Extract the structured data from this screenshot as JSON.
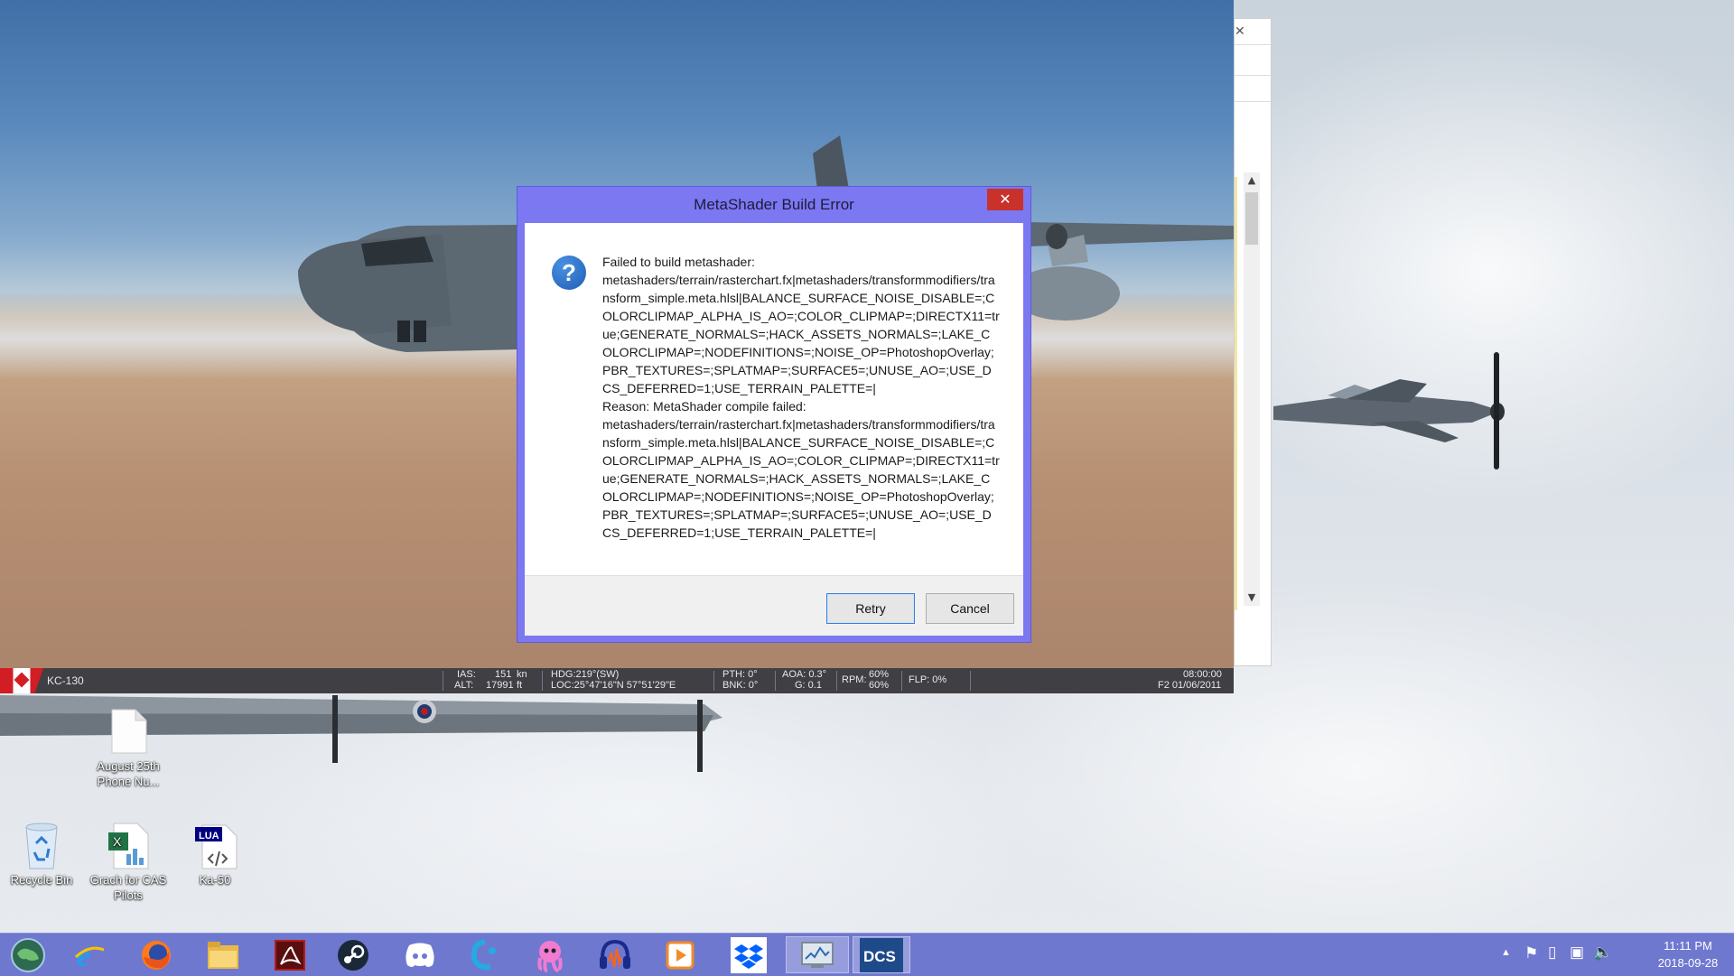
{
  "dialog": {
    "title": "MetaShader Build Error",
    "close_glyph": "✕",
    "message": "Failed to build metashader:\nmetashaders/terrain/rasterchart.fx|metashaders/transformmodifiers/transform_simple.meta.hlsl|BALANCE_SURFACE_NOISE_DISABLE=;COLORCLIPMAP_ALPHA_IS_AO=;COLOR_CLIPMAP=;DIRECTX11=true;GENERATE_NORMALS=;HACK_ASSETS_NORMALS=;LAKE_COLORCLIPMAP=;NODEFINITIONS=;NOISE_OP=PhotoshopOverlay;PBR_TEXTURES=;SPLATMAP=;SURFACE5=;UNUSE_AO=;USE_DCS_DEFERRED=1;USE_TERRAIN_PALETTE=|\nReason: MetaShader compile failed:\nmetashaders/terrain/rasterchart.fx|metashaders/transformmodifiers/transform_simple.meta.hlsl|BALANCE_SURFACE_NOISE_DISABLE=;COLORCLIPMAP_ALPHA_IS_AO=;COLOR_CLIPMAP=;DIRECTX11=true;GENERATE_NORMALS=;HACK_ASSETS_NORMALS=;LAKE_COLORCLIPMAP=;NODEFINITIONS=;NOISE_OP=PhotoshopOverlay;PBR_TEXTURES=;SPLATMAP=;SURFACE5=;UNUSE_AO=;USE_DCS_DEFERRED=1;USE_TERRAIN_PALETTE=|",
    "icon": "question-icon",
    "buttons": {
      "retry": "Retry",
      "cancel": "Cancel"
    }
  },
  "hud": {
    "aircraft": "KC-130",
    "ias_label": "IAS:",
    "ias_value": "151",
    "ias_unit": "kn",
    "alt_label": "ALT:",
    "alt_value": "17991",
    "alt_unit": "ft",
    "hdg": "HDG:219°(SW)",
    "loc": "LOC:25°47'16\"N 57°51'29\"E",
    "pth": "PTH: 0°",
    "bnk": "BNK: 0°",
    "aoa": "AOA: 0.3°",
    "g": "G: 0.1",
    "rpm_label": "RPM:",
    "rpm1": "60%",
    "rpm2": "60%",
    "flp": "FLP: 0%",
    "time": "08:00:00",
    "date": "F2 01/06/2011"
  },
  "desktop_icons": [
    {
      "label": "August 25th Phone Nu...",
      "icon": "document-icon"
    },
    {
      "label": "Recycle Bin",
      "icon": "recycle-bin-icon"
    },
    {
      "label": "Grach for CAS Pilots",
      "icon": "excel-icon"
    },
    {
      "label": "Ka-50",
      "icon": "lua-file-icon",
      "badge": "LUA"
    }
  ],
  "taskbar": {
    "apps": [
      {
        "name": "start-icon"
      },
      {
        "name": "internet-explorer-icon"
      },
      {
        "name": "firefox-icon"
      },
      {
        "name": "file-explorer-icon"
      },
      {
        "name": "acrobat-icon"
      },
      {
        "name": "steam-icon"
      },
      {
        "name": "discord-icon"
      },
      {
        "name": "logitech-icon"
      },
      {
        "name": "octopus-app-icon"
      },
      {
        "name": "audacity-icon"
      },
      {
        "name": "media-player-icon"
      },
      {
        "name": "dropbox-icon"
      },
      {
        "name": "system-monitor-icon"
      },
      {
        "name": "dcs-icon"
      }
    ],
    "clock_time": "11:11 PM",
    "clock_date": "2018-09-28"
  },
  "colors": {
    "dialog_frame": "#7b78f2",
    "taskbar": "#6f78cf",
    "close_red": "#c9312b"
  }
}
